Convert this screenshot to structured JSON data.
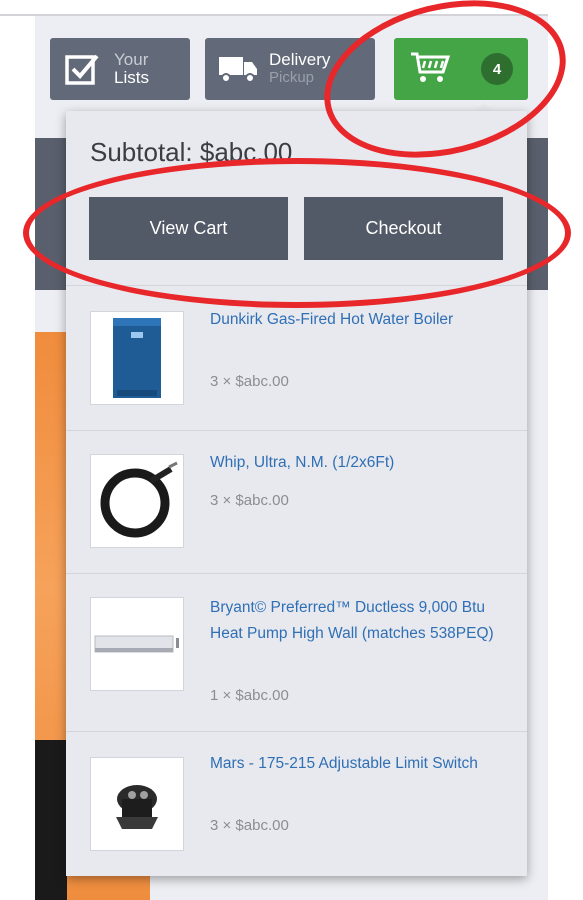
{
  "header": {
    "lists": {
      "line1": "Your",
      "line2": "Lists"
    },
    "delivery": {
      "line1": "Delivery",
      "line2": "Pickup"
    },
    "cart": {
      "count": "4"
    }
  },
  "cart_dropdown": {
    "subtotal": "Subtotal: $abc.00",
    "view_cart_label": "View Cart",
    "checkout_label": "Checkout",
    "items": [
      {
        "title": "Dunkirk Gas-Fired Hot Water Boiler",
        "qty": "3 × $abc.00"
      },
      {
        "title": "Whip, Ultra, N.M. (1/2x6Ft)",
        "qty": "3 × $abc.00"
      },
      {
        "title": "Bryant© Preferred™ Ductless 9,000 Btu Heat Pump High Wall (matches 538PEQ)",
        "qty": "1 × $abc.00"
      },
      {
        "title": "Mars - 175-215 Adjustable Limit Switch",
        "qty": "3 × $abc.00"
      }
    ]
  },
  "colors": {
    "cart_green": "#43a545",
    "nav_gray": "#626978",
    "link_blue": "#2f6fb5",
    "annotation_red": "#e8272b"
  }
}
